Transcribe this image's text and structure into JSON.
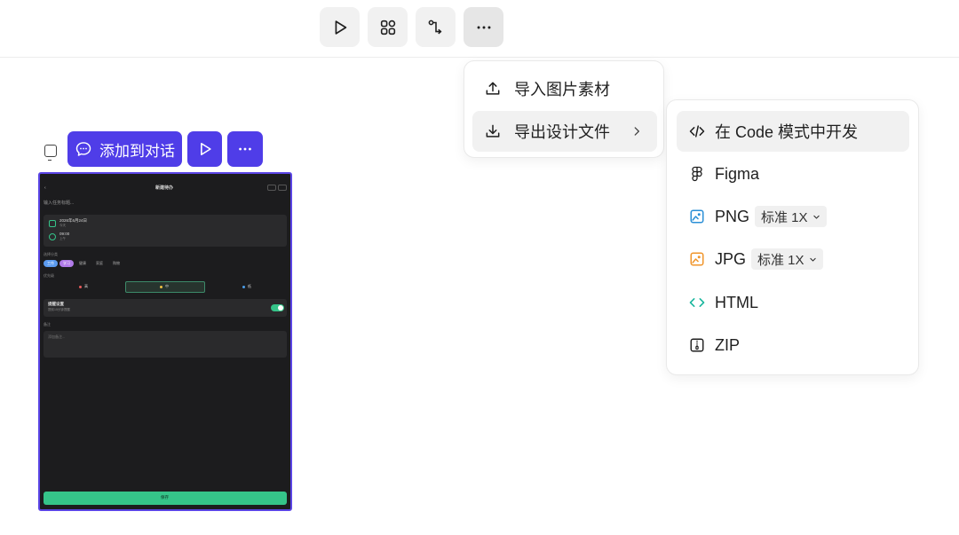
{
  "toolbar": {
    "buttons": [
      {
        "icon": "play-icon",
        "name": "run-button"
      },
      {
        "icon": "components-grid-icon",
        "name": "components-button"
      },
      {
        "icon": "flow-connector-icon",
        "name": "flow-button"
      },
      {
        "icon": "more-horizontal-icon",
        "name": "more-button"
      }
    ]
  },
  "selection_toolbar": {
    "add_to_chat_label": "添加到对话"
  },
  "phone_preview": {
    "title": "新建待办",
    "input_placeholder": "输入任务标题...",
    "date": "2026年6月24日",
    "date_sub": "今天",
    "time": "09:00",
    "time_sub": "上午",
    "category_label": "选择分类",
    "categories": [
      "工作",
      "学习",
      "健康",
      "家庭",
      "购物"
    ],
    "priority_label": "优先级",
    "priorities": [
      "高",
      "中",
      "低"
    ],
    "reminder_title": "提醒设置",
    "reminder_sub": "提前15分钟提醒",
    "notes_label": "备注",
    "notes_placeholder": "添加备注...",
    "save_label": "保存"
  },
  "menu_more": {
    "items": [
      {
        "label": "导入图片素材",
        "icon": "upload-icon"
      },
      {
        "label": "导出设计文件",
        "icon": "download-icon",
        "has_submenu": true
      }
    ]
  },
  "menu_export": {
    "items": [
      {
        "label": "在 Code 模式中开发",
        "icon": "code-icon"
      },
      {
        "label": "Figma",
        "icon": "figma-icon"
      },
      {
        "label": "PNG",
        "icon": "image-icon",
        "scale": "标准 1X",
        "icon_color": "#2b8fd6"
      },
      {
        "label": "JPG",
        "icon": "image-icon",
        "scale": "标准 1X",
        "icon_color": "#f0952b"
      },
      {
        "label": "HTML",
        "icon": "html-icon",
        "icon_color": "#1fb8a0"
      },
      {
        "label": "ZIP",
        "icon": "zip-icon"
      }
    ]
  },
  "colors": {
    "accent_purple": "#4f3de8",
    "phone_bg": "#1c1c1e",
    "save_green": "#35c489"
  }
}
